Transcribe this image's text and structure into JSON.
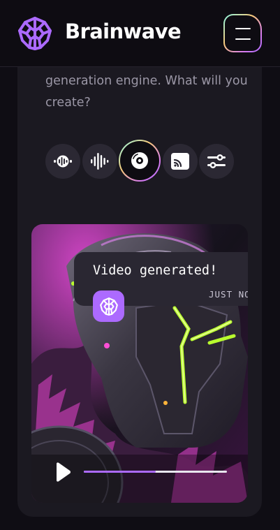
{
  "header": {
    "brand": "Brainwave",
    "logo_icon": "brain-chip-icon",
    "menu_icon": "menu-icon"
  },
  "intro": {
    "text": "generation engine. What will you create?"
  },
  "tools": [
    {
      "icon": "audio-wave-icon",
      "active": false
    },
    {
      "icon": "sound-bars-icon",
      "active": false
    },
    {
      "icon": "disc-icon",
      "active": true
    },
    {
      "icon": "cast-icon",
      "active": false
    },
    {
      "icon": "sliders-icon",
      "active": false
    }
  ],
  "video": {
    "progress": 0.5
  },
  "toast": {
    "title": "Video generated!",
    "time": "JUST NOW"
  },
  "colors": {
    "accent": "#ac6aff",
    "background": "#0f0d14",
    "card": "#1b1921",
    "toast": "#2a2732",
    "neon": "#b9ff2e",
    "magenta": "#e64bd7"
  }
}
